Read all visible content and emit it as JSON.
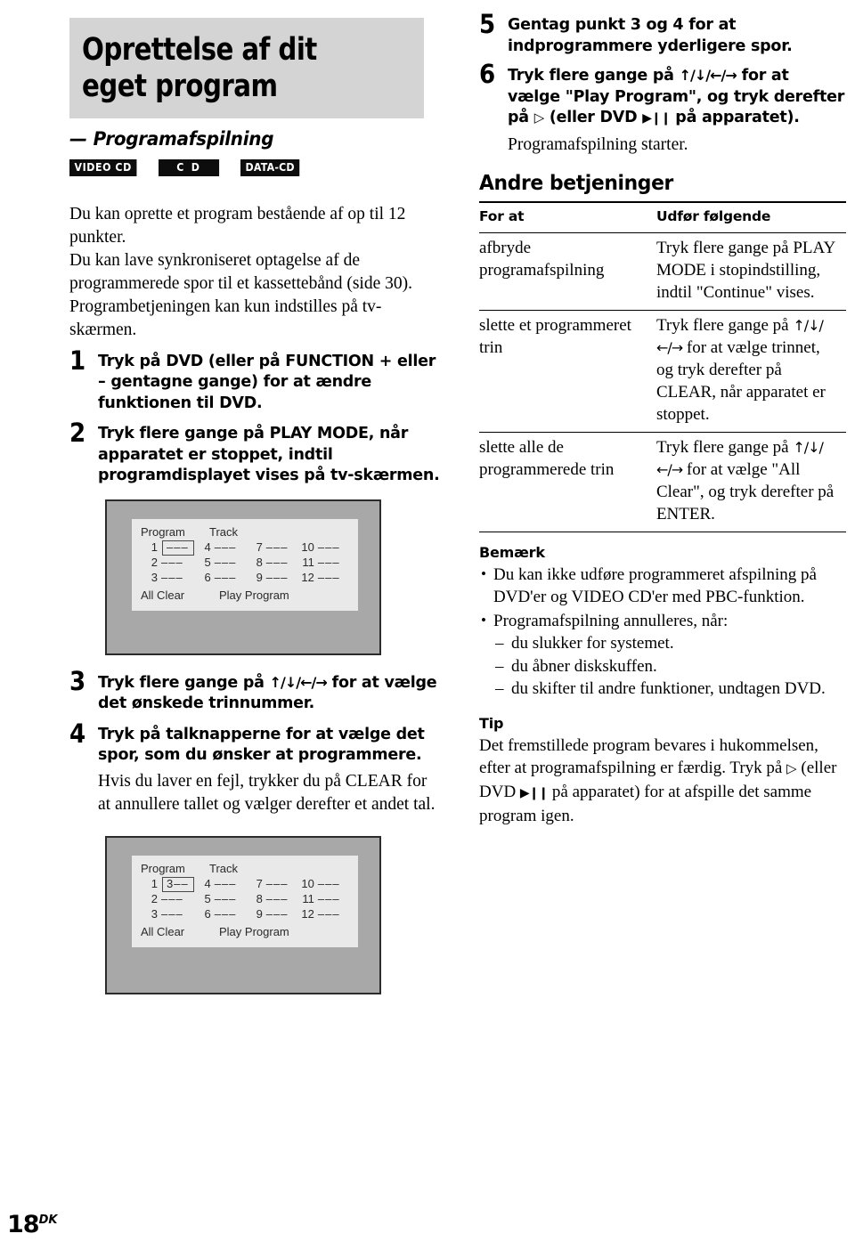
{
  "page": {
    "number": "18",
    "region_code": "DK"
  },
  "left": {
    "title": "Oprettelse af dit eget program",
    "subtitle_dash": "—",
    "subtitle": "Programafspilning",
    "badges": [
      {
        "label": "VIDEO CD",
        "name": "video-cd"
      },
      {
        "label": "C D",
        "name": "cd"
      },
      {
        "label": "DATA-CD",
        "name": "data-cd"
      }
    ],
    "intro": [
      "Du kan oprette et program bestående af op til 12 punkter.",
      "Du kan lave synkroniseret optagelse af de programmerede spor til et kassettebånd (side 30).",
      "Programbetjeningen kan kun indstilles på tv-skærmen."
    ],
    "steps": [
      {
        "num": "1",
        "text": "Tryk på DVD (eller på FUNCTION + eller – gentagne gange) for at ændre funktionen til DVD."
      },
      {
        "num": "2",
        "text": "Tryk flere gange på PLAY MODE, når apparatet er stoppet, indtil programdisplayet vises på tv-skærmen."
      },
      {
        "num": "3",
        "text_before": "Tryk flere gange på ",
        "arrows": "↑/↓/←/→",
        "text_after": " for at vælge det ønskede trinnummer."
      },
      {
        "num": "4",
        "text": "Tryk på talknapperne for at vælge det spor, som du ønsker at programmere.",
        "note": "Hvis du laver en fejl, trykker du på CLEAR for at annullere tallet og vælger derefter et andet tal."
      }
    ]
  },
  "osd1": {
    "header_program": "Program",
    "header_track": "Track",
    "columns": [
      {
        "entries": [
          {
            "index": "1",
            "value": "–––",
            "selected": true
          },
          {
            "index": "2",
            "value": "–––",
            "selected": false
          },
          {
            "index": "3",
            "value": "–––",
            "selected": false
          }
        ]
      },
      {
        "entries": [
          {
            "index": "4",
            "value": "–––",
            "selected": false
          },
          {
            "index": "5",
            "value": "–––",
            "selected": false
          },
          {
            "index": "6",
            "value": "–––",
            "selected": false
          }
        ]
      },
      {
        "entries": [
          {
            "index": "7",
            "value": "–––",
            "selected": false
          },
          {
            "index": "8",
            "value": "–––",
            "selected": false
          },
          {
            "index": "9",
            "value": "–––",
            "selected": false
          }
        ]
      },
      {
        "entries": [
          {
            "index": "10",
            "value": "–––",
            "selected": false
          },
          {
            "index": "11",
            "value": "–––",
            "selected": false
          },
          {
            "index": "12",
            "value": "–––",
            "selected": false
          }
        ]
      }
    ],
    "all_clear": "All Clear",
    "play_program": "Play Program"
  },
  "osd2": {
    "header_program": "Program",
    "header_track": "Track",
    "columns": [
      {
        "entries": [
          {
            "index": "1",
            "value": "3––",
            "selected": true
          },
          {
            "index": "2",
            "value": "–––",
            "selected": false
          },
          {
            "index": "3",
            "value": "–––",
            "selected": false
          }
        ]
      },
      {
        "entries": [
          {
            "index": "4",
            "value": "–––",
            "selected": false
          },
          {
            "index": "5",
            "value": "–––",
            "selected": false
          },
          {
            "index": "6",
            "value": "–––",
            "selected": false
          }
        ]
      },
      {
        "entries": [
          {
            "index": "7",
            "value": "–––",
            "selected": false
          },
          {
            "index": "8",
            "value": "–––",
            "selected": false
          },
          {
            "index": "9",
            "value": "–––",
            "selected": false
          }
        ]
      },
      {
        "entries": [
          {
            "index": "10",
            "value": "–––",
            "selected": false
          },
          {
            "index": "11",
            "value": "–––",
            "selected": false
          },
          {
            "index": "12",
            "value": "–––",
            "selected": false
          }
        ]
      }
    ],
    "all_clear": "All Clear",
    "play_program": "Play Program"
  },
  "right": {
    "step5": {
      "num": "5",
      "text": "Gentag punkt 3 og 4 for at indprogrammere yderligere spor."
    },
    "step6": {
      "num": "6",
      "part1": "Tryk flere gange på ",
      "arrows": "↑/↓/←/→",
      "part2": " for at vælge \"Play Program\", og tryk derefter på ",
      "play_glyph": "▷",
      "part3": " (eller DVD ",
      "playpause_glyph": "▶❙❙",
      "part4": " på apparatet).",
      "note": "Programafspilning starter."
    },
    "section_title": "Andre betjeninger",
    "table": {
      "headers": [
        "For at",
        "Udfør følgende"
      ],
      "rows": [
        {
          "action": "afbryde programafspilning",
          "howto": "Tryk flere gange på PLAY MODE i stopindstilling, indtil \"Continue\" vises."
        },
        {
          "action": "slette et programmeret trin",
          "howto_pre": "Tryk flere gange på ",
          "howto_arrows1": "↑/↓/",
          "howto_arrows2": "←/→",
          "howto_post": " for at vælge trinnet, og tryk derefter på CLEAR, når apparatet er stoppet."
        },
        {
          "action": "slette alle de programmerede trin",
          "howto_pre": "Tryk flere gange på ",
          "howto_arrows1": "↑/↓/",
          "howto_arrows2": "←/→",
          "howto_post": " for at vælge \"All Clear\", og tryk derefter på ENTER."
        }
      ]
    },
    "note_heading": "Bemærk",
    "notes": [
      "Du kan ikke udføre programmeret afspilning på DVD'er og VIDEO CD'er med PBC-funktion.",
      "Programafspilning annulleres, når:"
    ],
    "sub_notes": [
      "du slukker for systemet.",
      "du åbner diskskuffen.",
      "du skifter til andre funktioner, undtagen DVD."
    ],
    "tip_heading": "Tip",
    "tip": {
      "part1": "Det fremstillede program bevares i hukommelsen, efter at programafspilning er færdig. Tryk på ",
      "play_glyph": "▷",
      "part2": " (eller DVD ",
      "playpause_glyph": "▶❙❙",
      "part3": " på apparatet) for at afspille det samme program igen."
    }
  },
  "colors": {
    "title_band": "#d4d4d4",
    "tv_body": "#a8a8a8",
    "osd_panel": "#e9e9e9",
    "badge_bg": "#0d0d0d"
  }
}
